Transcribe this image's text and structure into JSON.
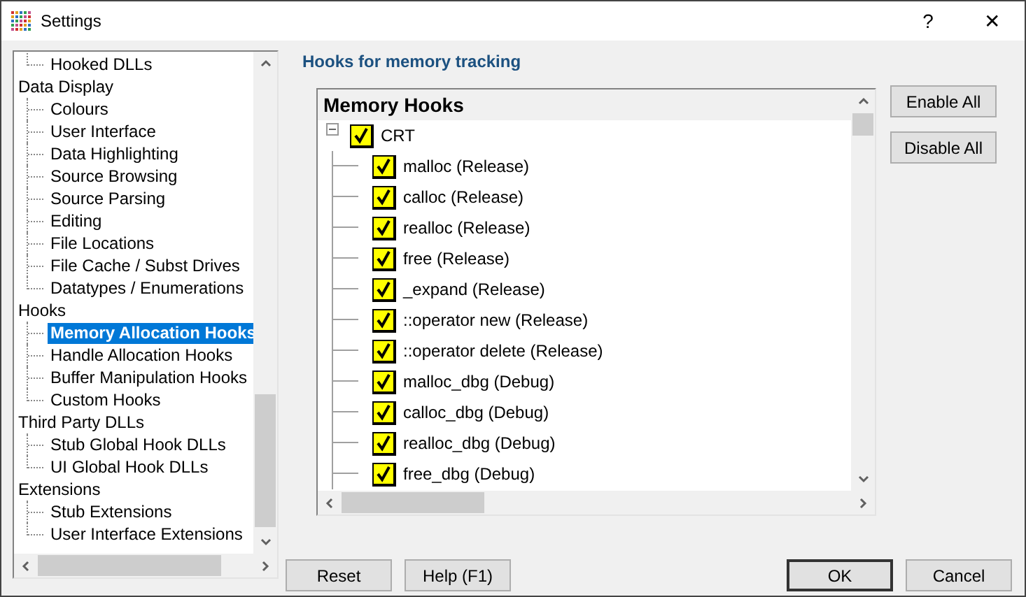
{
  "window": {
    "title": "Settings",
    "help_glyph": "?",
    "close_glyph": "✕"
  },
  "sidebar": {
    "items": [
      {
        "children": [
          {
            "label": "Hooked DLLs",
            "selected": false
          }
        ]
      },
      {
        "label": "Data Display",
        "children": [
          {
            "label": "Colours",
            "selected": false
          },
          {
            "label": "User Interface",
            "selected": false
          },
          {
            "label": "Data Highlighting",
            "selected": false
          },
          {
            "label": "Source Browsing",
            "selected": false
          },
          {
            "label": "Source Parsing",
            "selected": false
          },
          {
            "label": "Editing",
            "selected": false
          },
          {
            "label": "File Locations",
            "selected": false
          },
          {
            "label": "File Cache / Subst Drives",
            "selected": false
          },
          {
            "label": "Datatypes / Enumerations",
            "selected": false
          }
        ]
      },
      {
        "label": "Hooks",
        "children": [
          {
            "label": "Memory Allocation Hooks",
            "selected": true
          },
          {
            "label": "Handle Allocation Hooks",
            "selected": false
          },
          {
            "label": "Buffer Manipulation Hooks",
            "selected": false
          },
          {
            "label": "Custom Hooks",
            "selected": false
          }
        ]
      },
      {
        "label": "Third Party DLLs",
        "children": [
          {
            "label": "Stub Global Hook DLLs",
            "selected": false
          },
          {
            "label": "UI Global Hook DLLs",
            "selected": false
          }
        ]
      },
      {
        "label": "Extensions",
        "children": [
          {
            "label": "Stub Extensions",
            "selected": false
          },
          {
            "label": "User Interface Extensions",
            "selected": false
          }
        ]
      }
    ]
  },
  "section_title": "Hooks for memory tracking",
  "hooks": {
    "title": "Memory Hooks",
    "items": [
      {
        "label": "CRT",
        "checked": true,
        "expanded": true,
        "children": [
          {
            "label": "malloc (Release)",
            "checked": true
          },
          {
            "label": "calloc (Release)",
            "checked": true
          },
          {
            "label": "realloc (Release)",
            "checked": true
          },
          {
            "label": "free (Release)",
            "checked": true
          },
          {
            "label": "_expand (Release)",
            "checked": true
          },
          {
            "label": "::operator new (Release)",
            "checked": true
          },
          {
            "label": "::operator delete (Release)",
            "checked": true
          },
          {
            "label": "malloc_dbg (Debug)",
            "checked": true
          },
          {
            "label": "calloc_dbg (Debug)",
            "checked": true
          },
          {
            "label": "realloc_dbg (Debug)",
            "checked": true
          },
          {
            "label": "free_dbg (Debug)",
            "checked": true
          }
        ]
      }
    ]
  },
  "side_buttons": [
    "Enable All",
    "Disable All"
  ],
  "left_buttons": [
    "Reset",
    "Help (F1)"
  ],
  "right_buttons": [
    {
      "label": "OK",
      "default": true
    },
    {
      "label": "Cancel",
      "default": false
    }
  ]
}
